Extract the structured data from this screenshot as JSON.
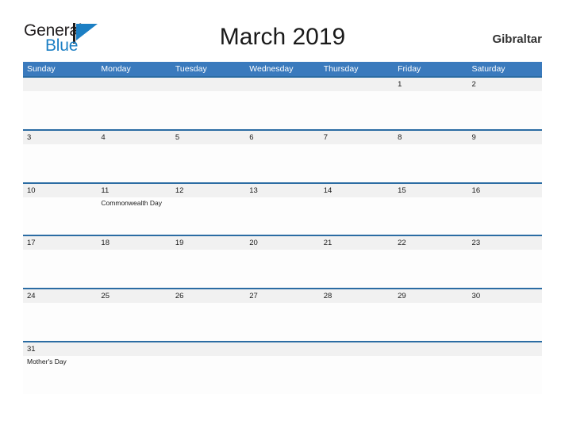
{
  "brand": {
    "name_part1": "General",
    "name_part2": "Blue"
  },
  "header": {
    "title": "March 2019",
    "locale": "Gibraltar"
  },
  "calendar": {
    "weekdays": [
      "Sunday",
      "Monday",
      "Tuesday",
      "Wednesday",
      "Thursday",
      "Friday",
      "Saturday"
    ],
    "weeks": [
      [
        {
          "date": "",
          "event": ""
        },
        {
          "date": "",
          "event": ""
        },
        {
          "date": "",
          "event": ""
        },
        {
          "date": "",
          "event": ""
        },
        {
          "date": "",
          "event": ""
        },
        {
          "date": "1",
          "event": ""
        },
        {
          "date": "2",
          "event": ""
        }
      ],
      [
        {
          "date": "3",
          "event": ""
        },
        {
          "date": "4",
          "event": ""
        },
        {
          "date": "5",
          "event": ""
        },
        {
          "date": "6",
          "event": ""
        },
        {
          "date": "7",
          "event": ""
        },
        {
          "date": "8",
          "event": ""
        },
        {
          "date": "9",
          "event": ""
        }
      ],
      [
        {
          "date": "10",
          "event": ""
        },
        {
          "date": "11",
          "event": "Commonwealth Day"
        },
        {
          "date": "12",
          "event": ""
        },
        {
          "date": "13",
          "event": ""
        },
        {
          "date": "14",
          "event": ""
        },
        {
          "date": "15",
          "event": ""
        },
        {
          "date": "16",
          "event": ""
        }
      ],
      [
        {
          "date": "17",
          "event": ""
        },
        {
          "date": "18",
          "event": ""
        },
        {
          "date": "19",
          "event": ""
        },
        {
          "date": "20",
          "event": ""
        },
        {
          "date": "21",
          "event": ""
        },
        {
          "date": "22",
          "event": ""
        },
        {
          "date": "23",
          "event": ""
        }
      ],
      [
        {
          "date": "24",
          "event": ""
        },
        {
          "date": "25",
          "event": ""
        },
        {
          "date": "26",
          "event": ""
        },
        {
          "date": "27",
          "event": ""
        },
        {
          "date": "28",
          "event": ""
        },
        {
          "date": "29",
          "event": ""
        },
        {
          "date": "30",
          "event": ""
        }
      ],
      [
        {
          "date": "31",
          "event": "Mother's Day"
        },
        {
          "date": "",
          "event": ""
        },
        {
          "date": "",
          "event": ""
        },
        {
          "date": "",
          "event": ""
        },
        {
          "date": "",
          "event": ""
        },
        {
          "date": "",
          "event": ""
        },
        {
          "date": "",
          "event": ""
        }
      ]
    ]
  },
  "colors": {
    "header_blue": "#3a7abd",
    "rule_blue": "#2b6ca3",
    "band_gray": "#f1f1f1",
    "logo_blue": "#1c7fc4"
  }
}
